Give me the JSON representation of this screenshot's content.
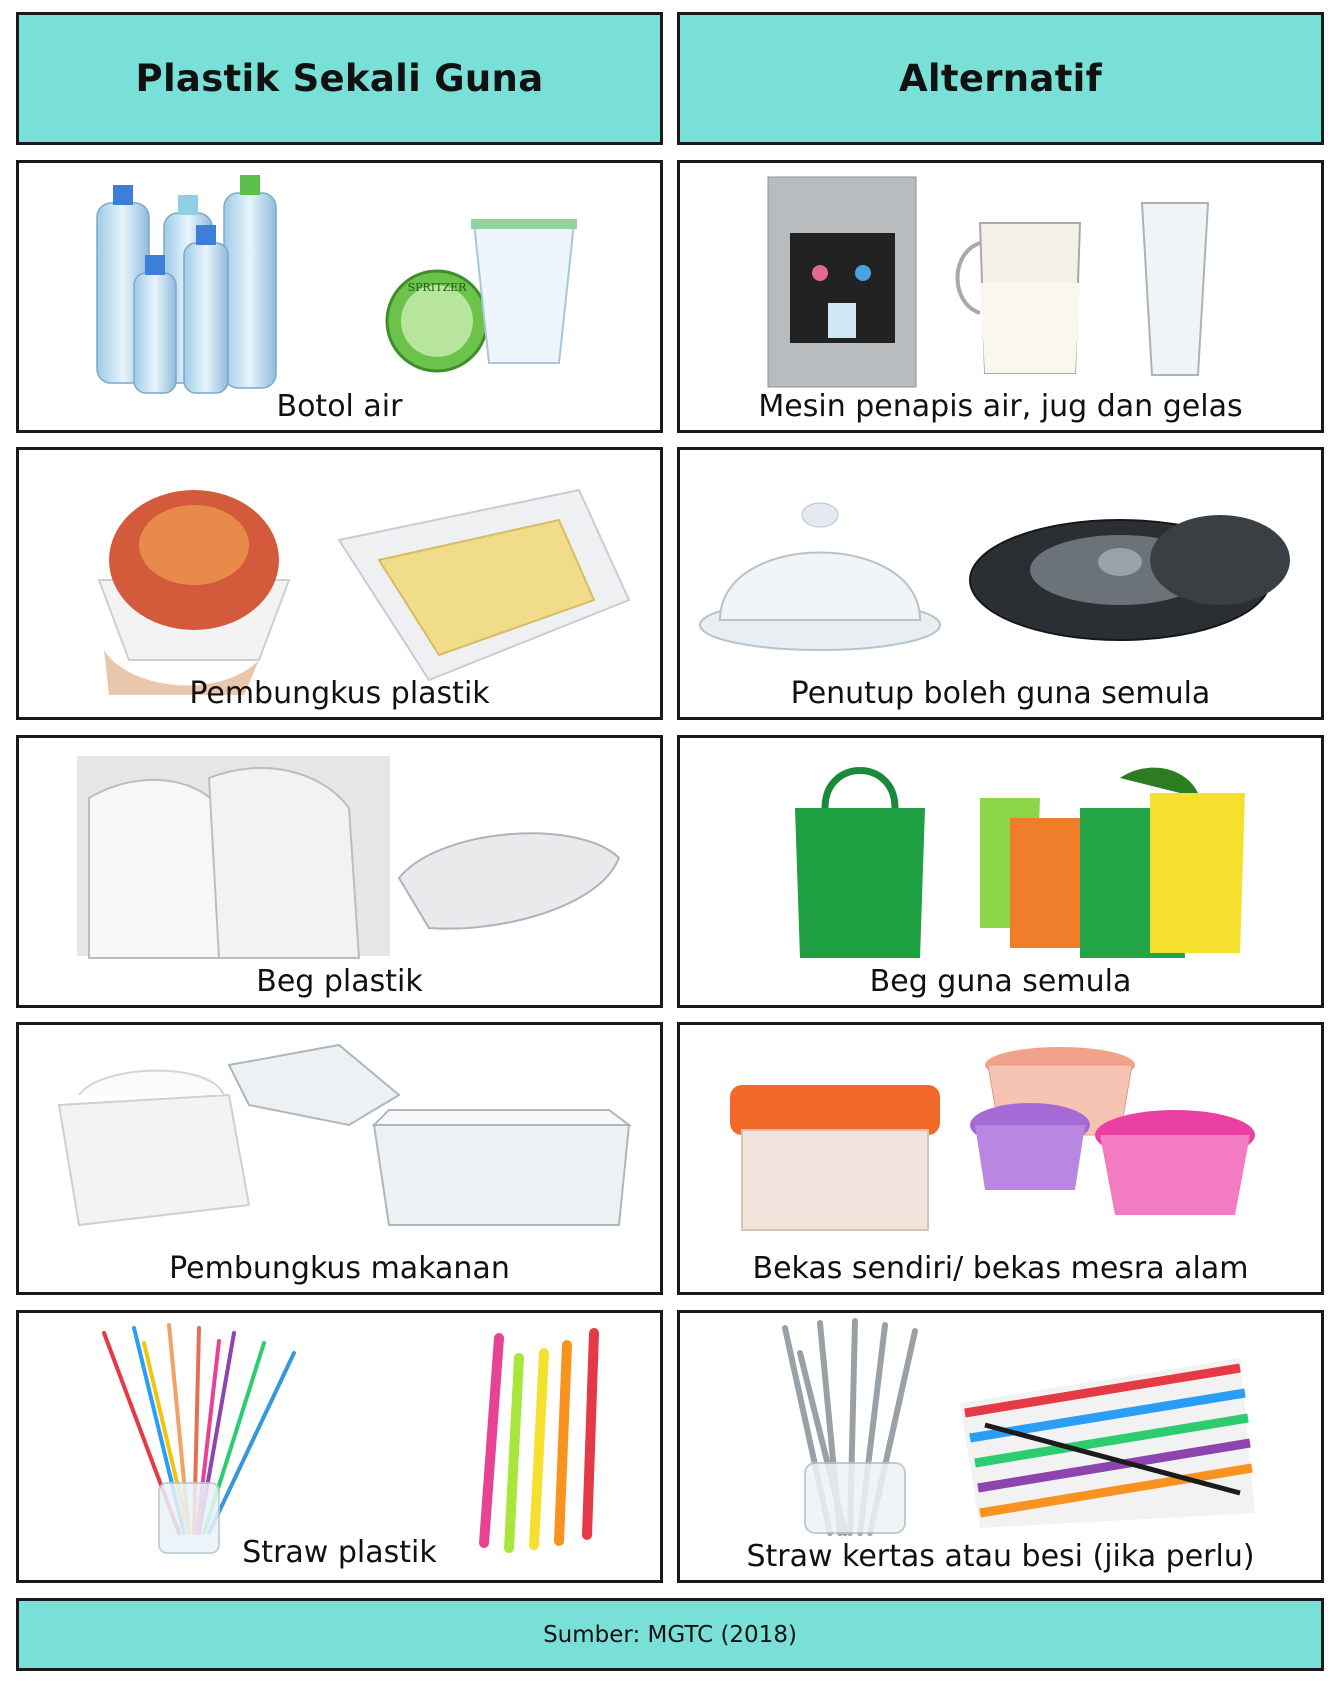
{
  "headers": {
    "left": "Plastik Sekali Guna",
    "right": "Alternatif"
  },
  "rows": [
    {
      "single_use": "Botol air",
      "alternative": "Mesin penapis air, jug dan gelas"
    },
    {
      "single_use": "Pembungkus plastik",
      "alternative": "Penutup boleh guna semula"
    },
    {
      "single_use": "Beg plastik",
      "alternative": "Beg guna semula"
    },
    {
      "single_use": "Pembungkus makanan",
      "alternative": "Bekas sendiri/ bekas mesra alam"
    },
    {
      "single_use": "Straw plastik",
      "alternative": "Straw kertas atau besi (jika perlu)"
    }
  ],
  "brand_text": "SPRITZER",
  "source": "Sumber: MGTC (2018)",
  "colors": {
    "teal": "#79e0d7",
    "border": "#1a1a1a"
  }
}
